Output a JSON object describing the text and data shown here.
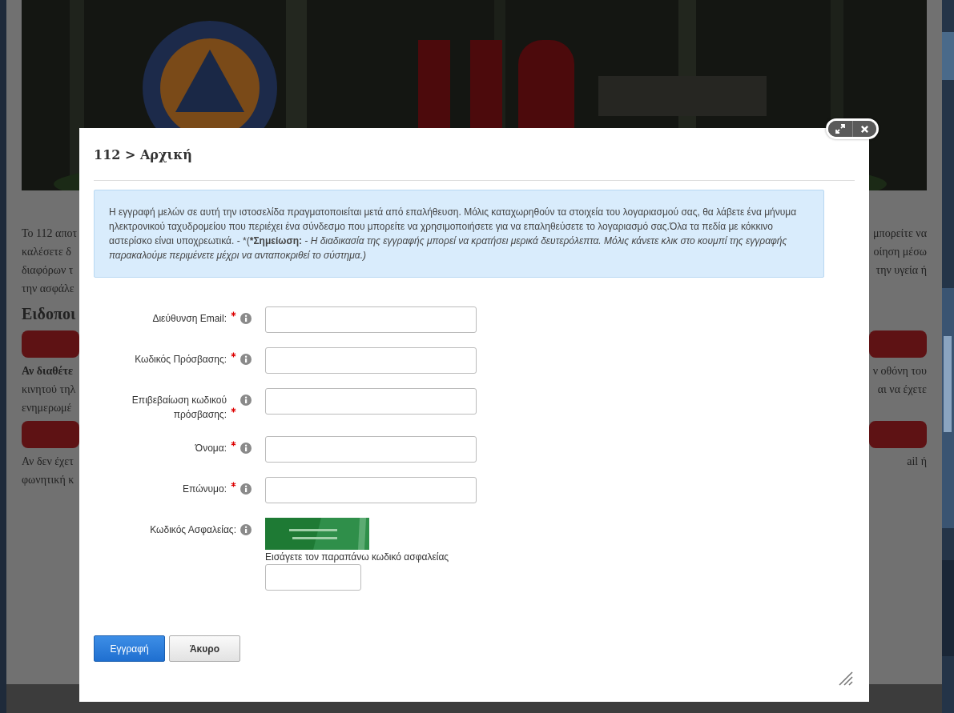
{
  "background_rows": [
    {
      "kind": "text",
      "left": "Το 112 αποτ",
      "right": "μπορείτε να"
    },
    {
      "kind": "text",
      "left": "καλέσετε δ",
      "right": "οίηση μέσω"
    },
    {
      "kind": "text",
      "left": "διαφόρων τ",
      "right": "την υγεία ή"
    },
    {
      "kind": "text",
      "left": "την ασφάλε"
    },
    {
      "kind": "heading",
      "left": "Ειδοποι"
    },
    {
      "kind": "bar"
    },
    {
      "kind": "bold",
      "left": "Αν διαθέτε",
      "right": "ν οθόνη του"
    },
    {
      "kind": "text",
      "left": "κινητού τηλ",
      "right": "αι να έχετε"
    },
    {
      "kind": "text",
      "left": "ενημερωμέ"
    },
    {
      "kind": "bar"
    },
    {
      "kind": "text",
      "left": "Αν δεν έχετ",
      "right": "ail ή"
    },
    {
      "kind": "text",
      "left": "φωνητική κ"
    }
  ],
  "dialog": {
    "title": "112 > Αρχική",
    "notice": "Η εγγραφή μελών σε αυτή την ιστοσελίδα πραγματοποιείται μετά από επαλήθευση. Μόλις καταχωρηθούν τα στοιχεία του λογαριασμού σας, θα λάβετε ένα μήνυμα ηλεκτρονικού ταχυδρομείου που περιέχει ένα σύνδεσμο που μπορείτε να χρησιμοποιήσετε για να επαληθεύσετε το λογαριασμό σας.Όλα τα πεδία με κόκκινο αστερίσκο είναι υποχρεωτικά. - *(***Σημείωση:** *- Η διαδικασία της εγγραφής μπορεί να κρατήσει μερικά δευτερόλεπτα. Μόλις κάνετε κλικ στο κουμπί της εγγραφής παρακαλούμε περιμένετε μέχρι να ανταποκριθεί το σύστημα.)*",
    "fields": [
      {
        "kind": "text",
        "label": "Διεύθυνση Email:",
        "required": true
      },
      {
        "kind": "text",
        "label": "Κωδικός Πρόσβασης:",
        "required": true
      },
      {
        "kind": "text",
        "label": "Επιβεβαίωση κωδικού πρόσβασης:",
        "required": true
      },
      {
        "kind": "text",
        "label": "Όνομα:",
        "required": true
      },
      {
        "kind": "text",
        "label": "Επώνυμο:",
        "required": true
      },
      {
        "kind": "captcha",
        "label": "Κωδικός Ασφαλείας:",
        "required": false,
        "hint": "Εισάγετε τον παραπάνω κωδικό ασφαλείας"
      }
    ],
    "buttons": [
      {
        "label": "Εγγραφή",
        "kind": "primary"
      },
      {
        "label": "Άκυρο",
        "kind": "default"
      }
    ]
  }
}
